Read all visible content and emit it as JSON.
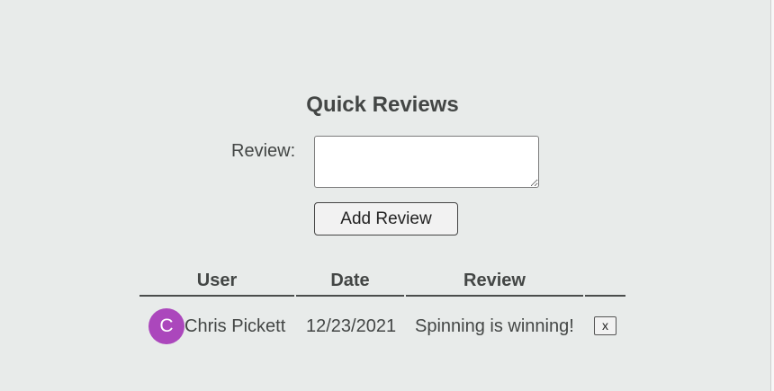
{
  "page": {
    "title": "Quick Reviews"
  },
  "form": {
    "review_label": "Review:",
    "review_value": "",
    "submit_label": "Add Review"
  },
  "table": {
    "columns": [
      "User",
      "Date",
      "Review",
      ""
    ],
    "rows": [
      {
        "avatar_initial": "C",
        "avatar_color": "#ab47bc",
        "user": "Chris Pickett",
        "date": "12/23/2021",
        "review": "Spinning is winning!",
        "delete_label": "x"
      }
    ]
  },
  "colors": {
    "background": "#e8ebea",
    "text": "#434645",
    "avatar": "#ab47bc"
  }
}
